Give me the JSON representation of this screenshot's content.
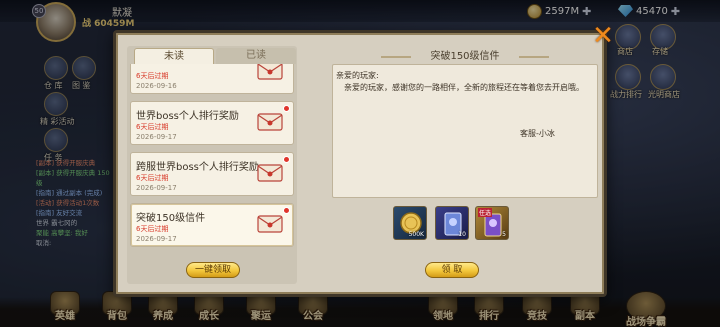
{
  "hud": {
    "vip": "50",
    "player_name": "默凝",
    "power": "战 60459M",
    "gold": "2597M",
    "gems": "45470",
    "left_labels": [
      "仓 库",
      "图 鉴",
      "精 彩活动",
      "任 务"
    ],
    "right_labels": [
      "商店",
      "存储",
      "战力排行",
      "光明商店"
    ],
    "chat": [
      {
        "text": "[副本] 获得开服庆典",
        "tone": "r"
      },
      {
        "text": "[副本] 获得开服庆典 150级",
        "tone": "g"
      },
      {
        "text": "[指南] 通过副本 (完成)",
        "tone": "b"
      },
      {
        "text": "[活动] 获得活动1次数",
        "tone": "r"
      },
      {
        "text": "[指南] 友好交流",
        "tone": "b"
      },
      {
        "text": "世界  霸七冈的",
        "tone": ""
      },
      {
        "text": "聚能 高攀坚: 我好",
        "tone": "g"
      },
      {
        "text": "取消:",
        "tone": ""
      }
    ]
  },
  "bottom_nav": [
    "英雄",
    "背包",
    "养成",
    "成长",
    "聚运",
    "公会",
    "领地",
    "排行",
    "竞技",
    "副本",
    "战场争霸"
  ],
  "mailbox": {
    "tabs": {
      "unread": "未读",
      "read": "已读"
    },
    "items": [
      {
        "title": "",
        "expiry": "6天后过期",
        "date": "2026-09-16",
        "unread": false
      },
      {
        "title": "世界boss个人排行奖励",
        "expiry": "6天后过期",
        "date": "2026-09-17",
        "unread": true
      },
      {
        "title": "跨服世界boss个人排行奖励",
        "expiry": "6天后过期",
        "date": "2026-09-17",
        "unread": true
      },
      {
        "title": "突破150级信件",
        "expiry": "6天后过期",
        "date": "2026-09-17",
        "unread": true
      }
    ],
    "claim_all_label": "一键领取",
    "detail": {
      "title": "突破150级信件",
      "greeting": "亲爱的玩家:",
      "body": "亲爱的玩家，感谢您的一路相伴，全新的旅程还在等着您去开启哦。",
      "signature": "客服-小冰",
      "rewards": [
        {
          "name": "gold-coin-reward",
          "qty": "500K",
          "tag": ""
        },
        {
          "name": "blue-card-reward",
          "qty": "10",
          "tag": ""
        },
        {
          "name": "purple-card-reward",
          "qty": "5",
          "tag": "任选"
        }
      ],
      "claim_label": "领 取"
    },
    "close_icon": "✕"
  },
  "colors": {
    "accent": "#f3c73c",
    "expiry": "#d83a2a",
    "close": "#f08a1c"
  }
}
